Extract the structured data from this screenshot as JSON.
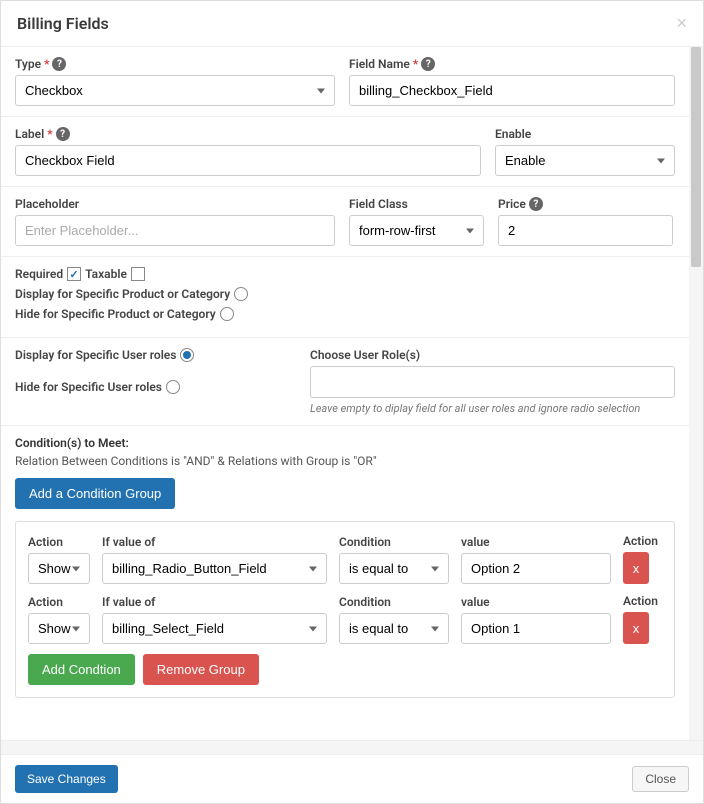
{
  "modal": {
    "title": "Billing Fields",
    "close_x": "×"
  },
  "fields": {
    "type": {
      "label": "Type",
      "value": "Checkbox"
    },
    "field_name": {
      "label": "Field Name",
      "value": "billing_Checkbox_Field"
    },
    "label": {
      "label": "Label",
      "value": "Checkbox Field"
    },
    "enable": {
      "label": "Enable",
      "value": "Enable"
    },
    "placeholder": {
      "label": "Placeholder",
      "value": "",
      "placeholder": "Enter Placeholder..."
    },
    "field_class": {
      "label": "Field Class",
      "value": "form-row-first"
    },
    "price": {
      "label": "Price",
      "value": "2"
    },
    "required": {
      "label": "Required",
      "checked": true
    },
    "taxable": {
      "label": "Taxable",
      "checked": false
    },
    "display_product": {
      "label": "Display for Specific Product or Category",
      "checked": false
    },
    "hide_product": {
      "label": "Hide for Specific Product or Category",
      "checked": false
    },
    "display_roles": {
      "label": "Display for Specific User roles",
      "checked": true
    },
    "hide_roles": {
      "label": "Hide for Specific User roles",
      "checked": false
    },
    "choose_roles": {
      "label": "Choose User Role(s)",
      "hint": "Leave empty to diplay field for all user roles and ignore radio selection"
    }
  },
  "conditions": {
    "title": "Condition(s) to Meet:",
    "subtitle": "Relation Between Conditions is \"AND\" & Relations with Group is \"OR\"",
    "add_group": "Add a Condition Group",
    "headers": {
      "action": "Action",
      "if": "If value of",
      "condition": "Condition",
      "value": "value",
      "del": "Action"
    },
    "rows": [
      {
        "action": "Show",
        "if": "billing_Radio_Button_Field",
        "cond": "is equal to",
        "value": "Option 2"
      },
      {
        "action": "Show",
        "if": "billing_Select_Field",
        "cond": "is equal to",
        "value": "Option 1"
      }
    ],
    "add_condition": "Add Condtion",
    "remove_group": "Remove Group",
    "remove_x": "x"
  },
  "footer": {
    "save": "Save Changes",
    "close": "Close"
  }
}
